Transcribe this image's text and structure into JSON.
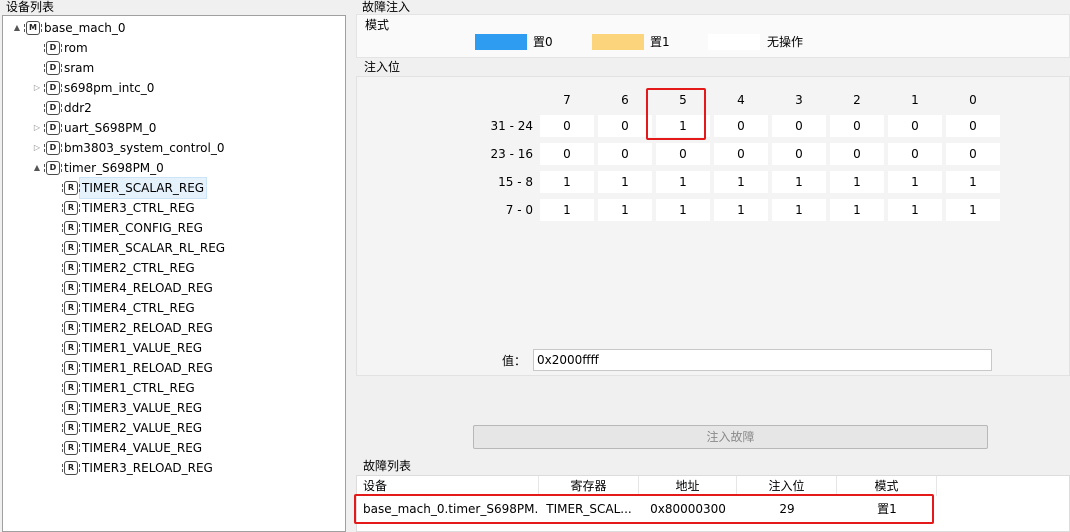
{
  "left_panel": {
    "title": "设备列表",
    "tree": [
      {
        "label": "base_mach_0",
        "icon": "machine-icon",
        "icon_letter": "M",
        "toggle": "▲",
        "depth": 0
      },
      {
        "label": "rom",
        "icon": "device-icon",
        "icon_letter": "D",
        "toggle": "",
        "depth": 1
      },
      {
        "label": "sram",
        "icon": "device-icon",
        "icon_letter": "D",
        "toggle": "",
        "depth": 1
      },
      {
        "label": "s698pm_intc_0",
        "icon": "device-icon",
        "icon_letter": "D",
        "toggle": "▷",
        "depth": 1
      },
      {
        "label": "ddr2",
        "icon": "device-icon",
        "icon_letter": "D",
        "toggle": "",
        "depth": 1
      },
      {
        "label": "uart_S698PM_0",
        "icon": "device-icon",
        "icon_letter": "D",
        "toggle": "▷",
        "depth": 1
      },
      {
        "label": "bm3803_system_control_0",
        "icon": "device-icon",
        "icon_letter": "D",
        "toggle": "▷",
        "depth": 1
      },
      {
        "label": "timer_S698PM_0",
        "icon": "device-icon",
        "icon_letter": "D",
        "toggle": "▲",
        "depth": 1
      },
      {
        "label": "TIMER_SCALAR_REG",
        "icon": "register-icon",
        "icon_letter": "R",
        "toggle": "",
        "depth": 2,
        "selected": true
      },
      {
        "label": "TIMER3_CTRL_REG",
        "icon": "register-icon",
        "icon_letter": "R",
        "toggle": "",
        "depth": 2
      },
      {
        "label": "TIMER_CONFIG_REG",
        "icon": "register-icon",
        "icon_letter": "R",
        "toggle": "",
        "depth": 2
      },
      {
        "label": "TIMER_SCALAR_RL_REG",
        "icon": "register-icon",
        "icon_letter": "R",
        "toggle": "",
        "depth": 2
      },
      {
        "label": "TIMER2_CTRL_REG",
        "icon": "register-icon",
        "icon_letter": "R",
        "toggle": "",
        "depth": 2
      },
      {
        "label": "TIMER4_RELOAD_REG",
        "icon": "register-icon",
        "icon_letter": "R",
        "toggle": "",
        "depth": 2
      },
      {
        "label": "TIMER4_CTRL_REG",
        "icon": "register-icon",
        "icon_letter": "R",
        "toggle": "",
        "depth": 2
      },
      {
        "label": "TIMER2_RELOAD_REG",
        "icon": "register-icon",
        "icon_letter": "R",
        "toggle": "",
        "depth": 2
      },
      {
        "label": "TIMER1_VALUE_REG",
        "icon": "register-icon",
        "icon_letter": "R",
        "toggle": "",
        "depth": 2
      },
      {
        "label": "TIMER1_RELOAD_REG",
        "icon": "register-icon",
        "icon_letter": "R",
        "toggle": "",
        "depth": 2
      },
      {
        "label": "TIMER1_CTRL_REG",
        "icon": "register-icon",
        "icon_letter": "R",
        "toggle": "",
        "depth": 2
      },
      {
        "label": "TIMER3_VALUE_REG",
        "icon": "register-icon",
        "icon_letter": "R",
        "toggle": "",
        "depth": 2
      },
      {
        "label": "TIMER2_VALUE_REG",
        "icon": "register-icon",
        "icon_letter": "R",
        "toggle": "",
        "depth": 2
      },
      {
        "label": "TIMER4_VALUE_REG",
        "icon": "register-icon",
        "icon_letter": "R",
        "toggle": "",
        "depth": 2
      },
      {
        "label": "TIMER3_RELOAD_REG",
        "icon": "register-icon",
        "icon_letter": "R",
        "toggle": "",
        "depth": 2
      }
    ]
  },
  "fault_injection": {
    "title": "故障注入",
    "mode": {
      "title": "模式",
      "legend": [
        {
          "label": "置0",
          "color": "#2d9cf1"
        },
        {
          "label": "置1",
          "color": "#fbd47b"
        },
        {
          "label": "无操作",
          "color": "#ffffff"
        }
      ]
    },
    "bits": {
      "title": "注入位",
      "col_headers": [
        "7",
        "6",
        "5",
        "4",
        "3",
        "2",
        "1",
        "0"
      ],
      "rows": [
        {
          "label": "31 - 24",
          "values": [
            "0",
            "0",
            "1",
            "0",
            "0",
            "0",
            "0",
            "0"
          ]
        },
        {
          "label": "23 - 16",
          "values": [
            "0",
            "0",
            "0",
            "0",
            "0",
            "0",
            "0",
            "0"
          ]
        },
        {
          "label": "15 - 8",
          "values": [
            "1",
            "1",
            "1",
            "1",
            "1",
            "1",
            "1",
            "1"
          ]
        },
        {
          "label": "7 - 0",
          "values": [
            "1",
            "1",
            "1",
            "1",
            "1",
            "1",
            "1",
            "1"
          ]
        }
      ]
    },
    "value_label": "值：",
    "value": "0x2000ffff",
    "inject_button": "注入故障"
  },
  "fault_list": {
    "title": "故障列表",
    "headers": [
      "设备",
      "寄存器",
      "地址",
      "注入位",
      "模式"
    ],
    "rows": [
      {
        "device": "base_mach_0.timer_S698PM...",
        "register": "TIMER_SCAL...",
        "address": "0x80000300",
        "bit": "29",
        "mode": "置1"
      }
    ]
  },
  "colors": {
    "highlight_border": "#e41a1a",
    "selection": "#e5f1fb"
  }
}
